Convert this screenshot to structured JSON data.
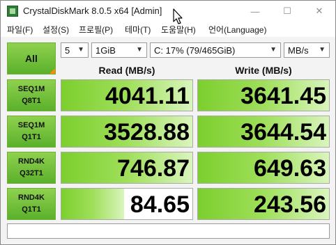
{
  "window": {
    "title": "CrystalDiskMark 8.0.5 x64 [Admin]",
    "controls": {
      "minimize": "—",
      "maximize": "☐",
      "close": "✕"
    }
  },
  "menu": {
    "file": "파일(F)",
    "settings": "설정(S)",
    "profile": "프로필(P)",
    "theme": "테마(T)",
    "help": "도움말(H)",
    "language": "언어(Language)"
  },
  "controls": {
    "all_label": "All",
    "count": "5",
    "size": "1GiB",
    "drive": "C: 17% (79/465GiB)",
    "unit": "MB/s"
  },
  "headers": {
    "read": "Read (MB/s)",
    "write": "Write (MB/s)"
  },
  "tests": [
    {
      "line1": "SEQ1M",
      "line2": "Q8T1",
      "read": "4041.11",
      "write": "3641.45"
    },
    {
      "line1": "SEQ1M",
      "line2": "Q1T1",
      "read": "3528.88",
      "write": "3644.54"
    },
    {
      "line1": "RND4K",
      "line2": "Q32T1",
      "read": "746.87",
      "write": "649.63"
    },
    {
      "line1": "RND4K",
      "line2": "Q1T1",
      "read": "84.65",
      "write": "243.56"
    }
  ],
  "bar_levels": [
    {
      "read": 1.0,
      "write": 1.0
    },
    {
      "read": 1.0,
      "write": 1.0
    },
    {
      "read": 1.0,
      "write": 1.0
    },
    {
      "read": 0.48,
      "write": 1.0
    }
  ],
  "comment": "",
  "colors": {
    "accent_green": "#5bb02b",
    "bar_green": "#7ccf2e",
    "corner_orange": "#ff8c00"
  }
}
